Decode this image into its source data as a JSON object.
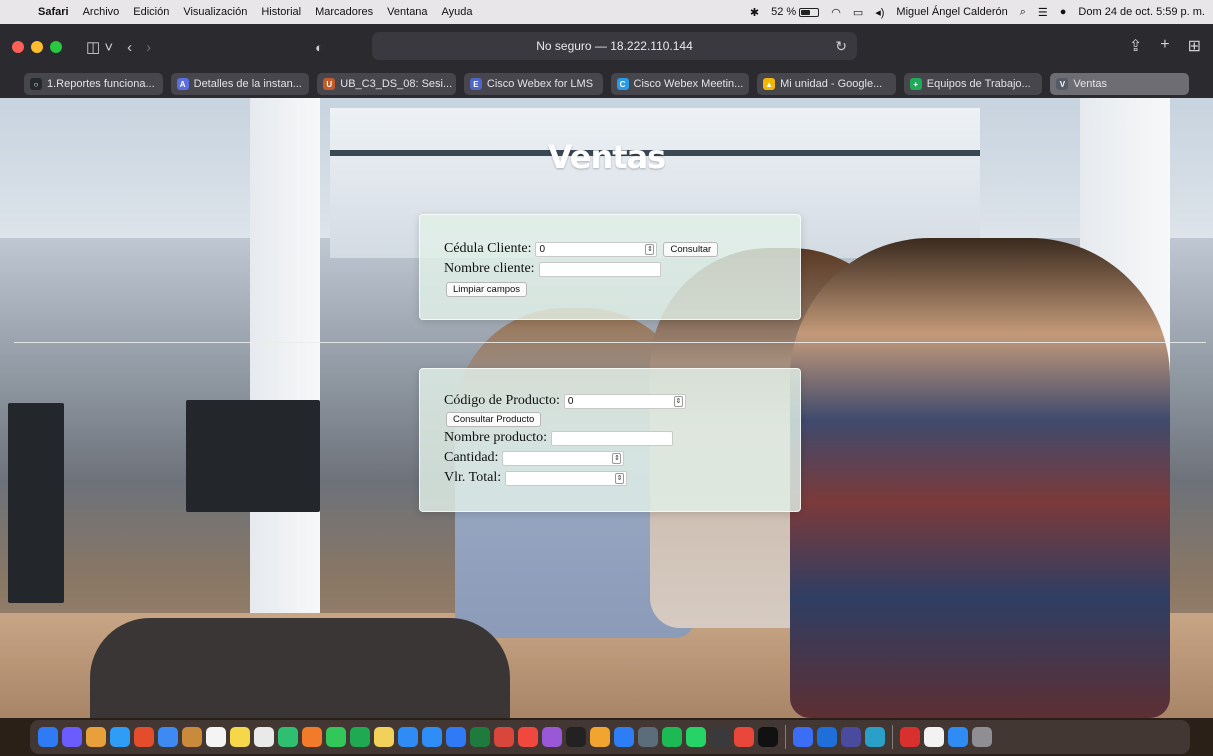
{
  "menubar": {
    "app": "Safari",
    "menus": [
      "Archivo",
      "Edición",
      "Visualización",
      "Historial",
      "Marcadores",
      "Ventana",
      "Ayuda"
    ],
    "battery": "52 %",
    "user": "Miguel Ángel Calderón",
    "datetime": "Dom 24 de oct.  5:59 p. m."
  },
  "browser": {
    "address": "No seguro — 18.222.110.144",
    "tabs": [
      {
        "label": "1.Reportes funciona...",
        "fav": "○",
        "color": "#24292e"
      },
      {
        "label": "Detalles de la instan...",
        "fav": "A",
        "color": "#5b6ee1"
      },
      {
        "label": "UB_C3_DS_08: Sesi...",
        "fav": "U",
        "color": "#c25a2a"
      },
      {
        "label": "Cisco Webex for LMS",
        "fav": "E",
        "color": "#4d66c8"
      },
      {
        "label": "Cisco Webex Meetin...",
        "fav": "C",
        "color": "#2a9be6"
      },
      {
        "label": "Mi unidad - Google...",
        "fav": "▲",
        "color": "#f2b705"
      },
      {
        "label": "Equipos de Trabajo...",
        "fav": "+",
        "color": "#1faa59"
      },
      {
        "label": "Ventas",
        "fav": "V",
        "color": "#555a66"
      }
    ]
  },
  "page": {
    "title": "Ventas",
    "cliente": {
      "cedula_label": "Cédula Cliente:",
      "cedula_value": "0",
      "consultar_label": "Consultar",
      "nombre_label": "Nombre cliente:",
      "limpiar_label": "Limpiar campos"
    },
    "producto": {
      "codigo_label": "Código de Producto:",
      "codigo_value": "0",
      "consultar_label": "Consultar Producto",
      "nombre_label": "Nombre producto:",
      "cantidad_label": "Cantidad:",
      "total_label": "Vlr. Total:"
    }
  },
  "dock": {
    "colors": [
      "#2f7bf5",
      "#6a5cff",
      "#e8a13a",
      "#2f9cf5",
      "#e34d2c",
      "#3d8bf2",
      "#c98a3b",
      "#f4f4f4",
      "#f6d74a",
      "#e9e9ea",
      "#2fbf71",
      "#f27b29",
      "#31c759",
      "#1ea952",
      "#f2d15a",
      "#2f8cf5",
      "#2e8df6",
      "#2f7bf5",
      "#1f7a3d",
      "#d9463b",
      "#f0473f",
      "#9b58d6",
      "#222",
      "#f2a431",
      "#2d7ef5",
      "#5d6c7a",
      "#1db954",
      "#25d366",
      "#3a3a3c",
      "#e8473a",
      "#111",
      "#3b6ef5",
      "#1e6fd9",
      "#4a4a9f",
      "#2aa0c8",
      "#d9302e",
      "#f2f2f2",
      "#2f8cf5",
      "#8e8e93"
    ]
  }
}
